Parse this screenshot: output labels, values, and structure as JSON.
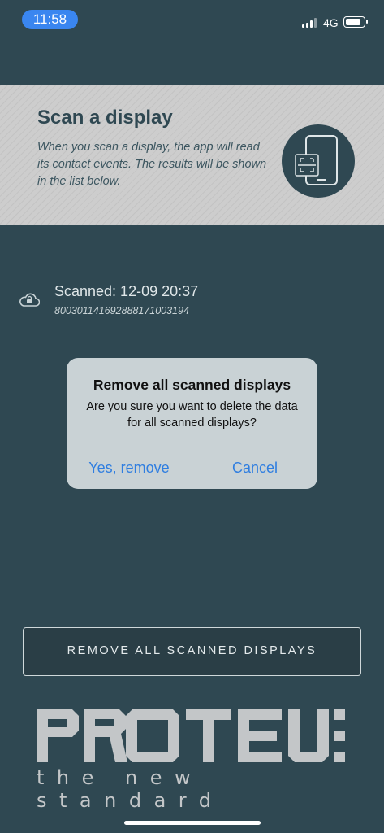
{
  "status_bar": {
    "time": "11:58",
    "network": "4G",
    "icons": [
      "signal-icon",
      "battery-icon"
    ]
  },
  "scan_card": {
    "title": "Scan a display",
    "description": "When you scan a display, the app will read its contact events. The results will be shown in the list below.",
    "icon": "phone-scan-icon"
  },
  "scanned_list": [
    {
      "icon": "cloud-lock-icon",
      "title": "Scanned: 12-09 20:37",
      "id": "800301141692888171003194"
    }
  ],
  "dialog": {
    "title": "Remove all scanned displays",
    "message": "Are you sure you want to delete the data for all scanned displays?",
    "confirm_label": "Yes, remove",
    "cancel_label": "Cancel"
  },
  "remove_button": {
    "label": "REMOVE ALL SCANNED DISPLAYS"
  },
  "logo": {
    "wordmark": "PROTEUS",
    "tagline": "the new standard"
  },
  "colors": {
    "background": "#2f4852",
    "card": "#cdcdcd",
    "accent_blue": "#2f7ee0",
    "time_pill": "#3a86f0"
  }
}
